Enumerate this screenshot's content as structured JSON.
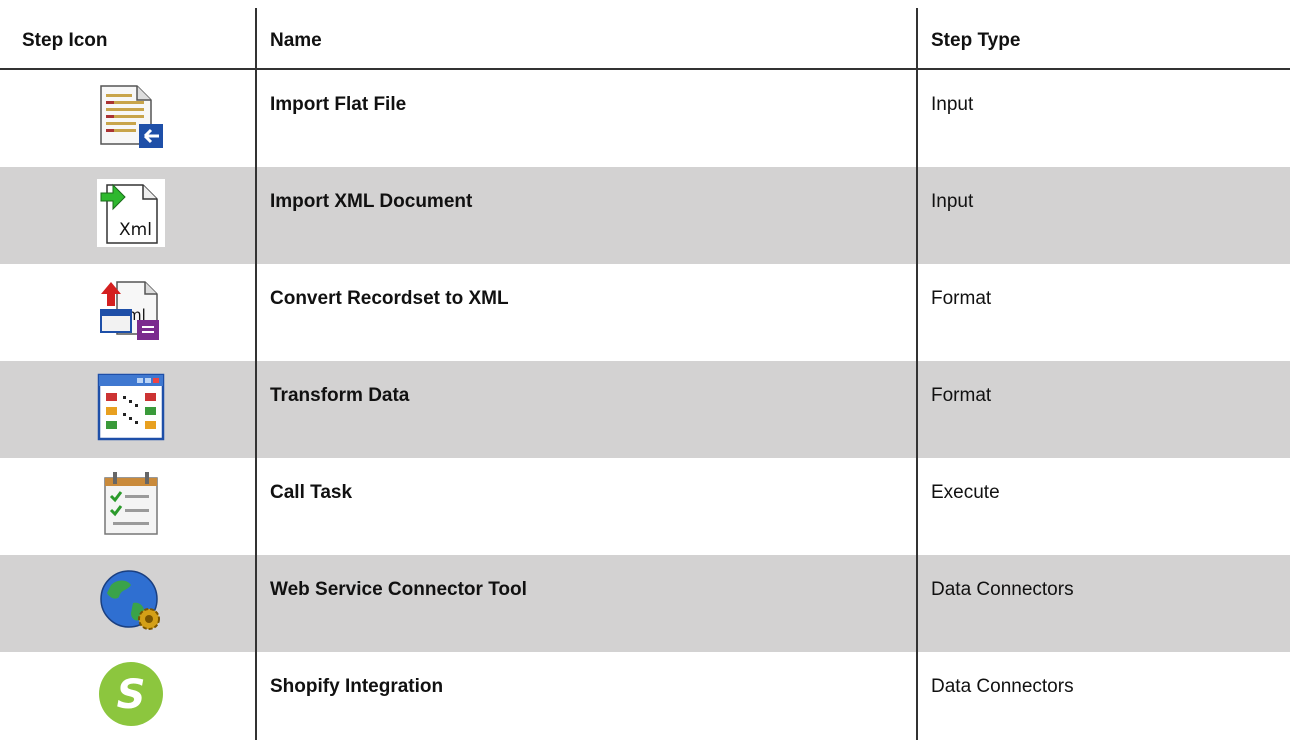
{
  "headers": {
    "icon": "Step Icon",
    "name": "Name",
    "type": "Step Type"
  },
  "rows": [
    {
      "icon": "flat-file-import-icon",
      "name": "Import Flat File",
      "type": "Input"
    },
    {
      "icon": "xml-document-import-icon",
      "name": "Import XML Document",
      "type": "Input"
    },
    {
      "icon": "recordset-to-xml-icon",
      "name": "Convert Recordset to XML",
      "type": "Format"
    },
    {
      "icon": "transform-data-icon",
      "name": "Transform Data",
      "type": "Format"
    },
    {
      "icon": "call-task-icon",
      "name": "Call Task",
      "type": "Execute"
    },
    {
      "icon": "globe-gear-icon",
      "name": "Web Service Connector Tool",
      "type": "Data Connectors"
    },
    {
      "icon": "shopify-icon",
      "name": "Shopify Integration",
      "type": "Data Connectors"
    }
  ],
  "colors": {
    "row_alt": "#d3d2d2",
    "rule": "#333333",
    "shopify_green": "#8cc63e"
  }
}
